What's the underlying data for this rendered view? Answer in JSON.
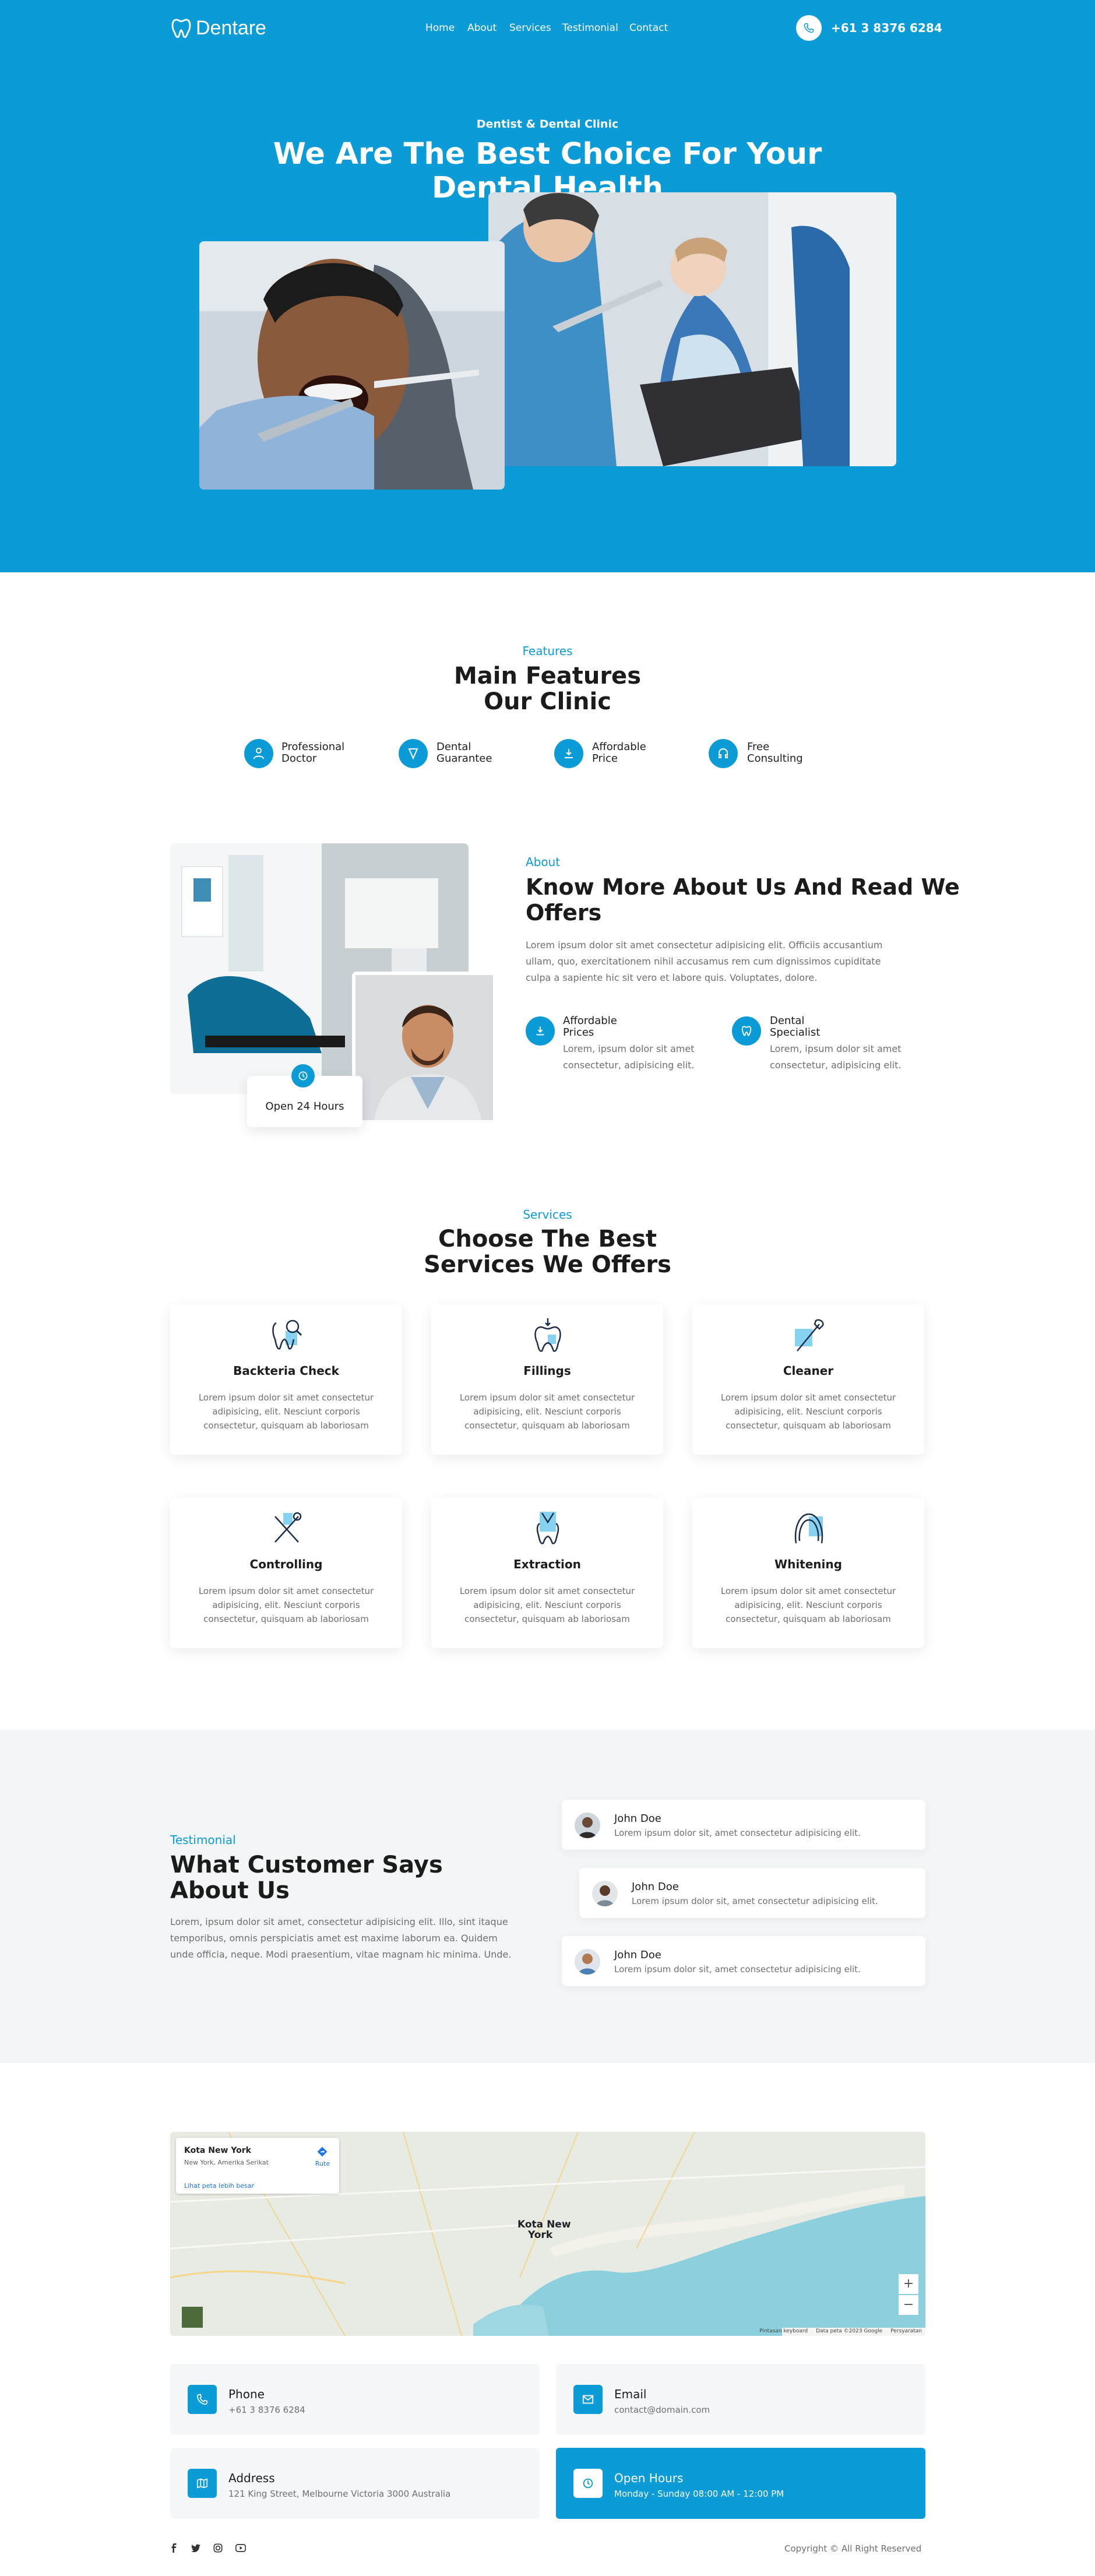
{
  "header": {
    "brand": "Dentare",
    "nav": [
      "Home",
      "About",
      "Services",
      "Testimonial",
      "Contact"
    ],
    "phone": "+61 3 8376 6284"
  },
  "hero": {
    "eyebrow": "Dentist & Dental Clinic",
    "title_line1": "We Are The Best Choice For Your",
    "title_line2": "Dental Health"
  },
  "features": {
    "eyebrow": "Features",
    "title_line1": "Main Features",
    "title_line2": "Our Clinic",
    "items": [
      {
        "line1": "Professional",
        "line2": "Doctor",
        "icon": "doctor-icon"
      },
      {
        "line1": "Dental",
        "line2": "Guarantee",
        "icon": "guarantee-icon"
      },
      {
        "line1": "Affordable",
        "line2": "Price",
        "icon": "price-icon"
      },
      {
        "line1": "Free",
        "line2": "Consulting",
        "icon": "consulting-icon"
      }
    ]
  },
  "about": {
    "eyebrow": "About",
    "title_line1": "Know More About Us And Read We",
    "title_line2": "Offers",
    "text_line1": "Lorem ipsum dolor sit amet consectetur adipisicing elit. Officiis accusantium",
    "text_line2": "ullam, quo, exercitationem nihil accusamus rem cum dignissimos cupiditate",
    "text_line3": "culpa a sapiente hic sit vero et labore quis. Voluptates, dolore.",
    "badge": "Open 24 Hours",
    "items": [
      {
        "line1": "Affordable",
        "line2": "Prices",
        "text1": "Lorem, ipsum dolor sit amet",
        "text2": "consectetur, adipisicing elit."
      },
      {
        "line1": "Dental",
        "line2": "Specialist",
        "text1": "Lorem, ipsum dolor sit amet",
        "text2": "consectetur, adipisicing elit."
      }
    ]
  },
  "services": {
    "eyebrow": "Services",
    "title_line1": "Choose The Best",
    "title_line2": "Services We Offers",
    "cards": [
      {
        "title": "Backteria Check",
        "l1": "Lorem ipsum dolor sit amet consectetur",
        "l2": "adipisicing, elit. Nesciunt corporis",
        "l3": "consectetur, quisquam ab laboriosam"
      },
      {
        "title": "Fillings",
        "l1": "Lorem ipsum dolor sit amet consectetur",
        "l2": "adipisicing, elit. Nesciunt corporis",
        "l3": "consectetur, quisquam ab laboriosam"
      },
      {
        "title": "Cleaner",
        "l1": "Lorem ipsum dolor sit amet consectetur",
        "l2": "adipisicing, elit. Nesciunt corporis",
        "l3": "consectetur, quisquam ab laboriosam"
      },
      {
        "title": "Controlling",
        "l1": "Lorem ipsum dolor sit amet consectetur",
        "l2": "adipisicing, elit. Nesciunt corporis",
        "l3": "consectetur, quisquam ab laboriosam"
      },
      {
        "title": "Extraction",
        "l1": "Lorem ipsum dolor sit amet consectetur",
        "l2": "adipisicing, elit. Nesciunt corporis",
        "l3": "consectetur, quisquam ab laboriosam"
      },
      {
        "title": "Whitening",
        "l1": "Lorem ipsum dolor sit amet consectetur",
        "l2": "adipisicing, elit. Nesciunt corporis",
        "l3": "consectetur, quisquam ab laboriosam"
      }
    ]
  },
  "testimonial": {
    "eyebrow": "Testimonial",
    "title_line1": "What Customer Says",
    "title_line2": "About Us",
    "text_line1": "Lorem, ipsum dolor sit amet, consectetur adipisicing elit. Illo, sint itaque",
    "text_line2": "temporibus, omnis perspiciatis amet est maxime laborum ea. Quidem",
    "text_line3": "unde officia, neque. Modi praesentium, vitae magnam hic minima. Unde.",
    "items": [
      {
        "name": "John Doe",
        "text": "Lorem ipsum dolor sit, amet consectetur adipisicing elit."
      },
      {
        "name": "John Doe",
        "text": "Lorem ipsum dolor sit, amet consectetur adipisicing elit."
      },
      {
        "name": "John Doe",
        "text": "Lorem ipsum dolor sit, amet consectetur adipisicing elit."
      }
    ]
  },
  "map": {
    "place": "Kota New York",
    "address": "New York, Amerika Serikat",
    "route": "Rute",
    "larger": "Lihat peta lebih besar",
    "city_line1": "Kota New",
    "city_line2": "York",
    "zoom_in": "+",
    "zoom_out": "−",
    "attribution1": "Pintasan keyboard",
    "attribution2": "Data peta ©2023 Google",
    "attribution3": "Persyaratan"
  },
  "contact": {
    "phone": {
      "label": "Phone",
      "value": "+61 3 8376 6284"
    },
    "email": {
      "label": "Email",
      "value": "contact@domain.com"
    },
    "address": {
      "label": "Address",
      "value": "121 King Street, Melbourne Victoria 3000 Australia"
    },
    "hours": {
      "label": "Open Hours",
      "value": "Monday - Sunday 08:00 AM - 12:00 PM"
    }
  },
  "footer": {
    "copyright": "Copyright © All Right Reserved",
    "social": [
      "facebook-icon",
      "twitter-icon",
      "instagram-icon",
      "youtube-icon"
    ]
  },
  "colors": {
    "accent": "#0b9bd7",
    "light_bg": "#f3f6f7"
  }
}
